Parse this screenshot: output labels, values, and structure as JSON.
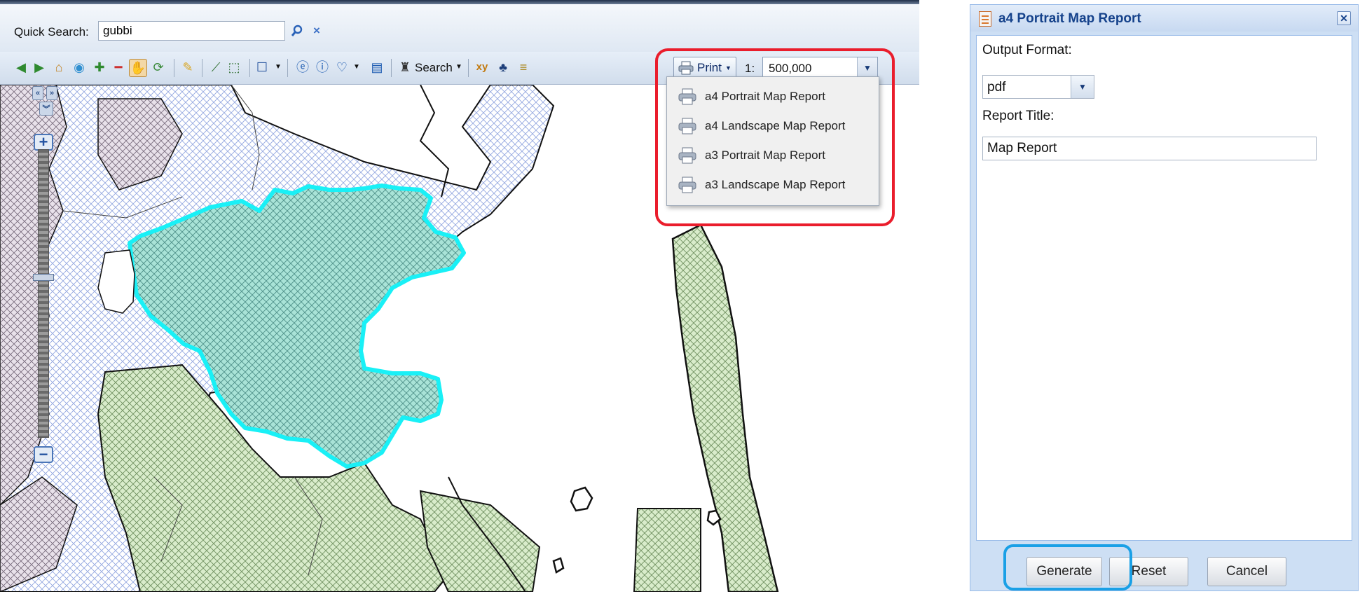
{
  "search": {
    "label": "Quick Search:",
    "value": "gubbi"
  },
  "toolbar": {
    "search_label": "Search",
    "print_label": "Print",
    "scale_prefix": "1:",
    "scale_value": "500,000"
  },
  "print_menu": {
    "items": [
      "a4 Portrait Map Report",
      "a4 Landscape Map Report",
      "a3 Portrait Map Report",
      "a3 Landscape Map Report"
    ]
  },
  "dialog": {
    "title": "a4 Portrait Map Report",
    "output_format_label": "Output Format:",
    "output_format_value": "pdf",
    "report_title_label": "Report Title:",
    "report_title_value": "Map Report",
    "buttons": {
      "generate": "Generate",
      "reset": "Reset",
      "cancel": "Cancel"
    }
  },
  "colors": {
    "highlight_red": "#ea1d2c",
    "highlight_blue": "#1aa0e6",
    "selection_outline": "#19f0f6",
    "title_text": "#15428b"
  }
}
